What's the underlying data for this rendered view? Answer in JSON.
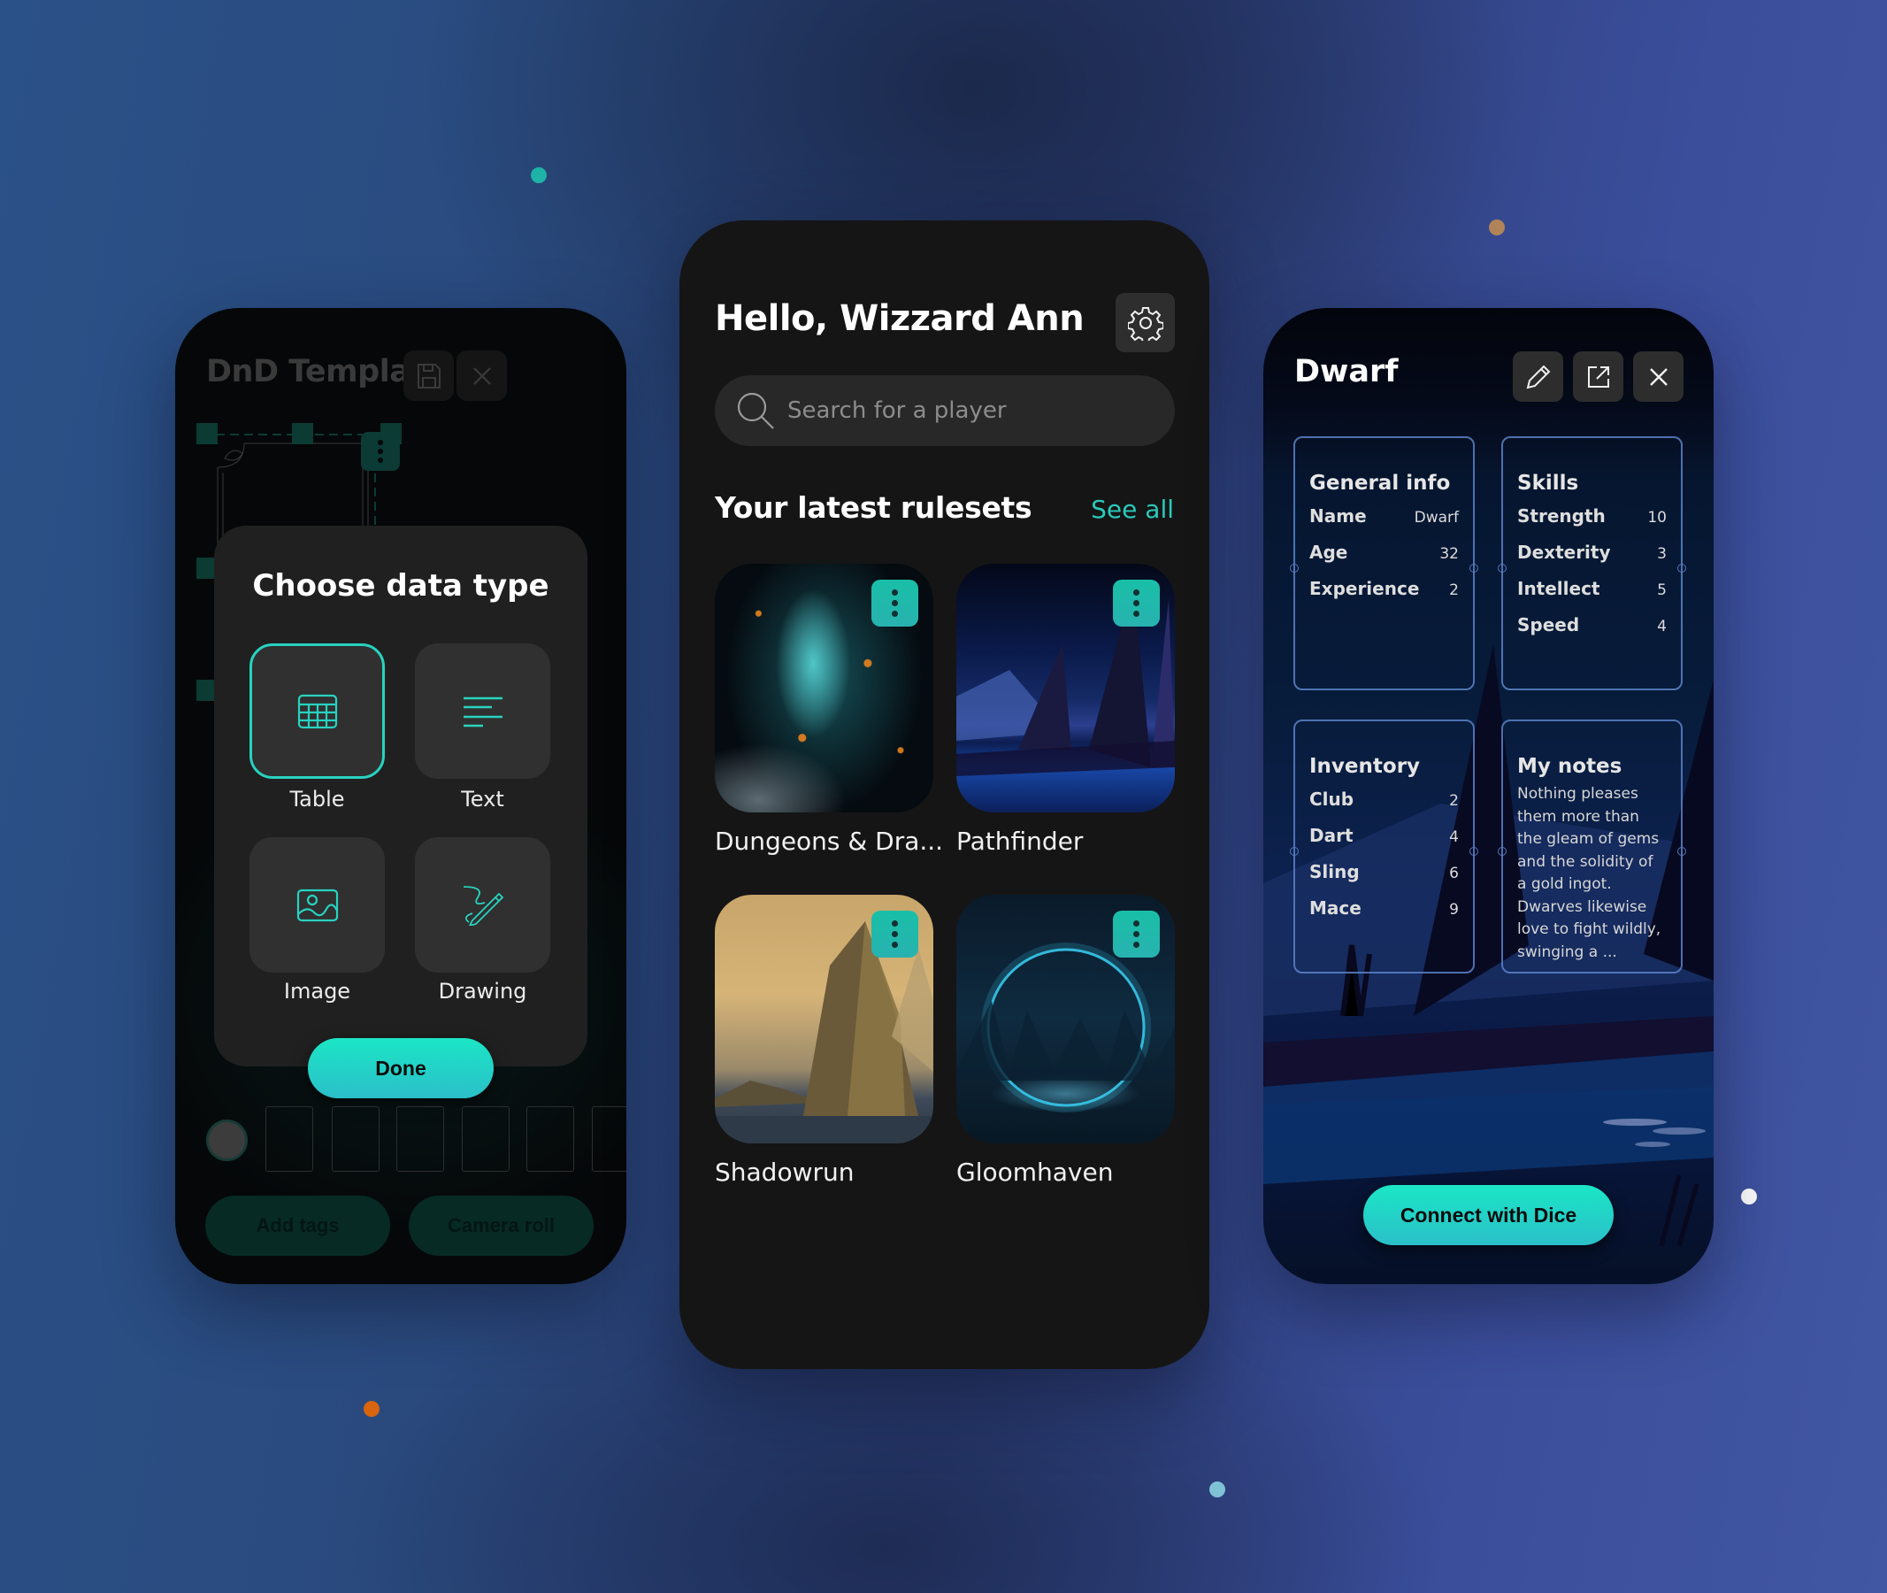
{
  "colors": {
    "accent": "#27d3c0",
    "accent_gradient_top": "#1be6c6",
    "accent_gradient_bottom": "#2bbfc8",
    "phone_dark": "#151515",
    "tile_bg": "#303030"
  },
  "decor_dots": [
    {
      "color": "#1fb2a6"
    },
    {
      "color": "#b08458"
    },
    {
      "color": "#d9650e"
    },
    {
      "color": "#7fc2d6"
    },
    {
      "color": "#ffffff"
    }
  ],
  "template_screen": {
    "title": "DnD Template",
    "save_icon": "save-icon",
    "close_icon": "close-icon",
    "dialog": {
      "title": "Choose data type",
      "options": [
        {
          "label": "Table",
          "icon": "table-icon",
          "selected": true
        },
        {
          "label": "Text",
          "icon": "text-icon",
          "selected": false
        },
        {
          "label": "Image",
          "icon": "image-icon",
          "selected": false
        },
        {
          "label": "Drawing",
          "icon": "drawing-icon",
          "selected": false
        }
      ],
      "done_label": "Done"
    },
    "add_tags_label": "Add tags",
    "camera_roll_label": "Camera roll"
  },
  "home_screen": {
    "greeting": "Hello, Wizzard Ann",
    "settings_icon": "gear-icon",
    "search": {
      "placeholder": "Search for a player",
      "value": ""
    },
    "section_title": "Your latest rulesets",
    "see_all_label": "See all",
    "rulesets": [
      {
        "name": "Dungeons & Dra..."
      },
      {
        "name": "Pathfinder"
      },
      {
        "name": "Shadowrun"
      },
      {
        "name": "Gloomhaven"
      }
    ]
  },
  "character_screen": {
    "title": "Dwarf",
    "general_info": {
      "title": "General info",
      "rows": [
        {
          "key": "Name",
          "value": "Dwarf"
        },
        {
          "key": "Age",
          "value": "32"
        },
        {
          "key": "Experience",
          "value": "2"
        }
      ]
    },
    "skills": {
      "title": "Skills",
      "rows": [
        {
          "key": "Strength",
          "value": "10"
        },
        {
          "key": "Dexterity",
          "value": "3"
        },
        {
          "key": "Intellect",
          "value": "5"
        },
        {
          "key": "Speed",
          "value": "4"
        }
      ]
    },
    "inventory": {
      "title": "Inventory",
      "rows": [
        {
          "key": "Club",
          "value": "2"
        },
        {
          "key": "Dart",
          "value": "4"
        },
        {
          "key": "Sling",
          "value": "6"
        },
        {
          "key": "Mace",
          "value": "9"
        }
      ]
    },
    "notes": {
      "title": "My notes",
      "text": "Nothing pleases them more than the gleam of gems and the solidity of a gold ingot. Dwarves likewise love to fight wildly, swinging a ..."
    },
    "connect_label": "Connect with Dice"
  }
}
